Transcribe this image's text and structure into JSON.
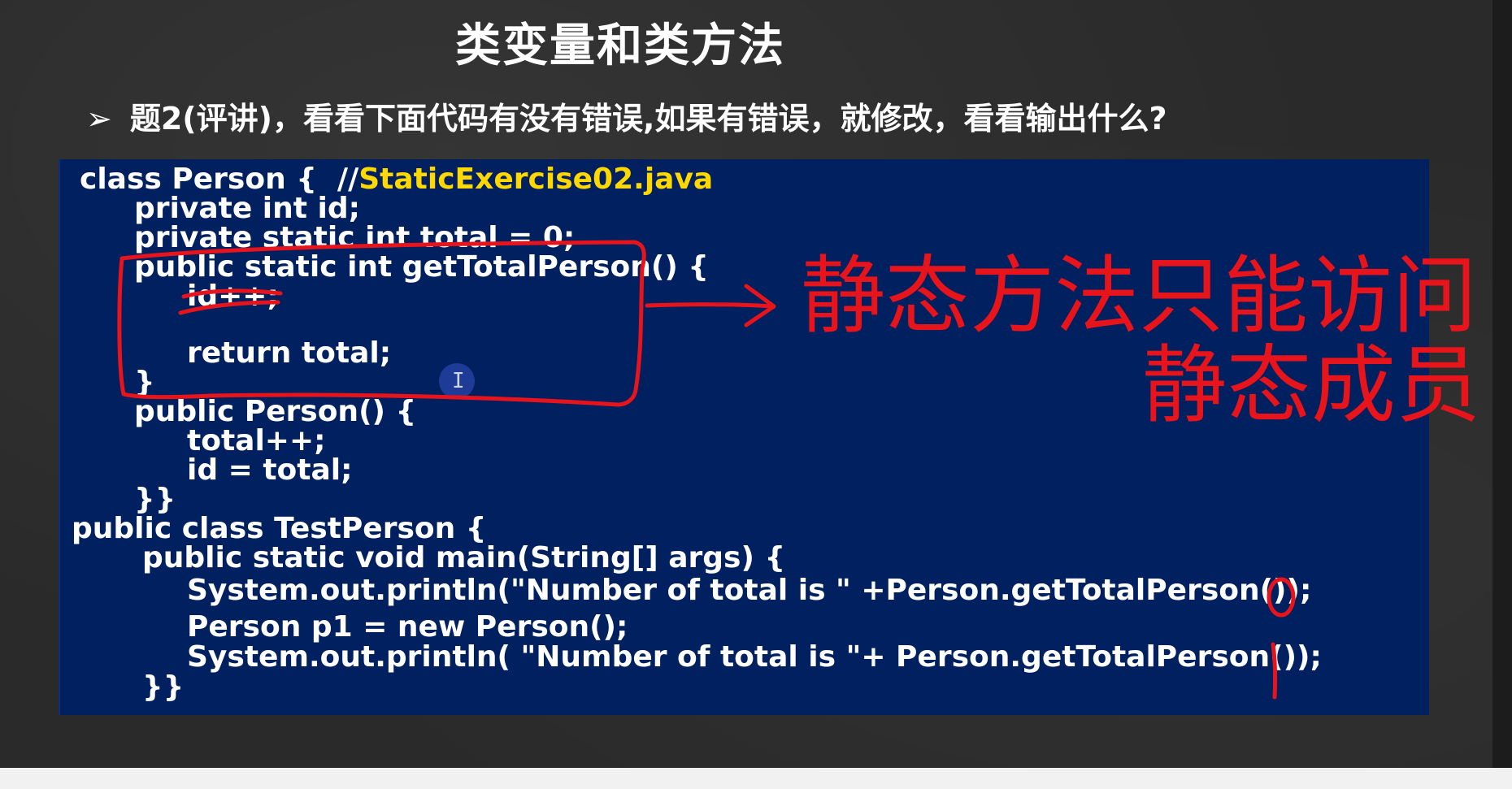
{
  "slide": {
    "title": "类变量和类方法",
    "question_bullet": "➢",
    "question": "题2(评讲)，看看下面代码有没有错误,如果有错误，就修改，看看输出什么?"
  },
  "code": {
    "line1_code": "class Person {  //",
    "line1_file": "StaticExercise02.java",
    "line2": "private int id;",
    "line3": "private static int total = 0;",
    "line4": "public static int getTotalPerson() {",
    "line5": "id++;",
    "line6": "return total;",
    "line7": "}",
    "line8": "public Person() {",
    "line9": "total++;",
    "line10": "id = total;",
    "line11": "}}",
    "line12": "public class TestPerson {",
    "line13": "public static void main(String[] args) {",
    "line14": "System.out.println(\"Number of total is \" +Person.getTotalPerson());",
    "line15": "Person p1 = new Person();",
    "line16": "System.out.println( \"Number of total is \"+ Person.getTotalPerson());",
    "line17": "}}"
  },
  "annotations": {
    "note_line1": "静态方法只能访问",
    "note_line2": "静态成员",
    "output_first": "0",
    "output_second": "1",
    "ink_color": "#e8141c"
  },
  "colors": {
    "slide_bg": "#2a2a2a",
    "code_bg": "#00205f",
    "code_text": "#ffffff",
    "filename_highlight": "#ffd800"
  }
}
